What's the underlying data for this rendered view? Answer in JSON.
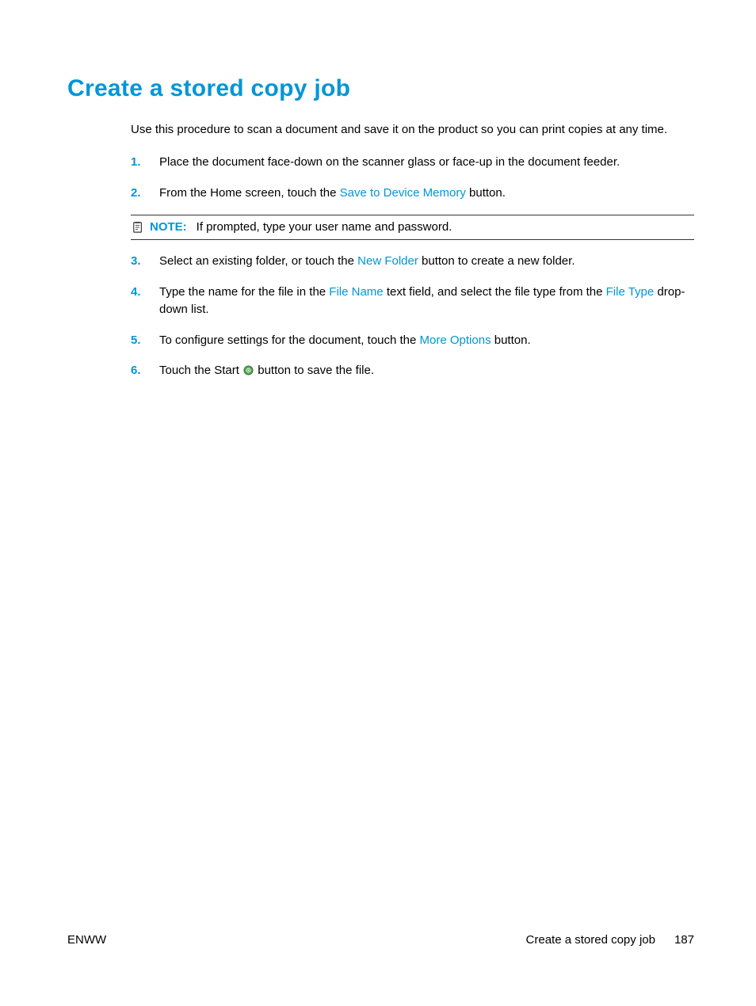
{
  "heading": "Create a stored copy job",
  "intro": "Use this procedure to scan a document and save it on the product so you can print copies at any time.",
  "steps": [
    {
      "num": "1.",
      "pre": "Place the document face-down on the scanner glass or face-up in the document feeder."
    },
    {
      "num": "2.",
      "pre": "From the Home screen, touch the ",
      "link1": "Save to Device Memory",
      "post": " button."
    },
    {
      "num": "3.",
      "pre": "Select an existing folder, or touch the ",
      "link1": "New Folder",
      "post": " button to create a new folder."
    },
    {
      "num": "4.",
      "pre": "Type the name for the file in the ",
      "link1": "File Name",
      "mid": " text field, and select the file type from the ",
      "link2": "File Type",
      "post": " drop-down list."
    },
    {
      "num": "5.",
      "pre": "To configure settings for the document, touch the ",
      "link1": "More Options",
      "post": " button."
    },
    {
      "num": "6.",
      "pre": "Touch the Start ",
      "post": " button to save the file."
    }
  ],
  "note": {
    "label": "NOTE:",
    "text": "If prompted, type your user name and password."
  },
  "footer": {
    "left": "ENWW",
    "section": "Create a stored copy job",
    "page": "187"
  }
}
